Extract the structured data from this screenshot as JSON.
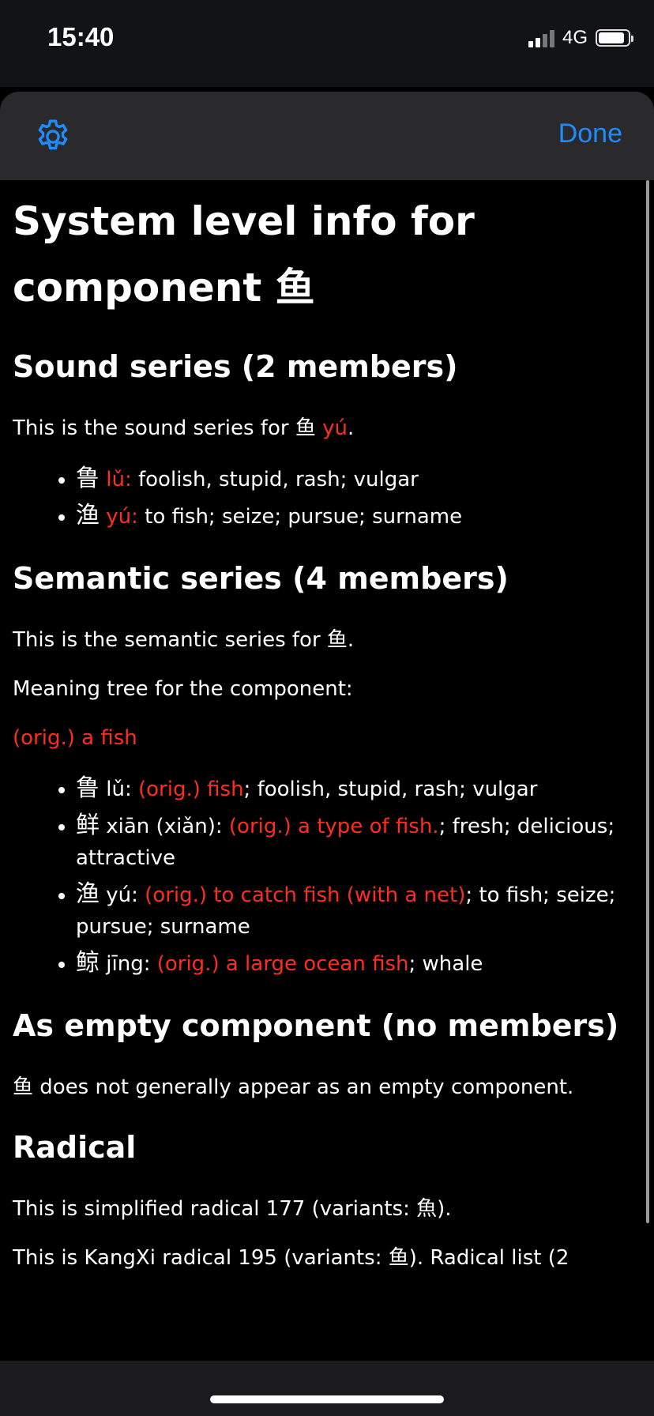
{
  "status_bar": {
    "time": "15:40",
    "network": "4G"
  },
  "header": {
    "done_label": "Done"
  },
  "title": "System level info for component 鱼",
  "sound_series": {
    "heading": "Sound series (2 members)",
    "intro_prefix": "This is the sound series for 鱼 ",
    "intro_pinyin": "yú",
    "intro_suffix": ".",
    "items": [
      {
        "char": "鲁",
        "pinyin": "lǔ:",
        "text": " foolish, stupid, rash; vulgar"
      },
      {
        "char": "渔",
        "pinyin": "yú:",
        "text": " to fish; seize; pursue; surname"
      }
    ]
  },
  "semantic_series": {
    "heading": "Semantic series (4 members)",
    "intro": "This is the semantic series for 鱼.",
    "tree_label": "Meaning tree for the component:",
    "root_meaning": "(orig.) a fish",
    "items": [
      {
        "char": "鲁",
        "pinyin": " lǔ: ",
        "orig": "(orig.) fish",
        "text": "; foolish, stupid, rash; vulgar"
      },
      {
        "char": "鲜",
        "pinyin": " xiān (xiǎn): ",
        "orig": "(orig.) a type of fish.",
        "text": "; fresh; delicious; attractive"
      },
      {
        "char": "渔",
        "pinyin": " yú: ",
        "orig": "(orig.) to catch fish (with a net)",
        "text": "; to fish; seize; pursue; surname"
      },
      {
        "char": "鲸",
        "pinyin": " jīng: ",
        "orig": "(orig.) a large ocean fish",
        "text": "; whale"
      }
    ]
  },
  "empty_component": {
    "heading": "As empty component (no members)",
    "text": "鱼 does not generally appear as an empty component."
  },
  "radical": {
    "heading": "Radical",
    "line1": "This is simplified radical 177 (variants: 魚).",
    "line2": "This is KangXi radical 195 (variants: 鱼). Radical list (2"
  },
  "colors": {
    "accent": "#1f8bff",
    "highlight": "#ff2d20"
  },
  "icons": {
    "settings": "gear-icon"
  }
}
